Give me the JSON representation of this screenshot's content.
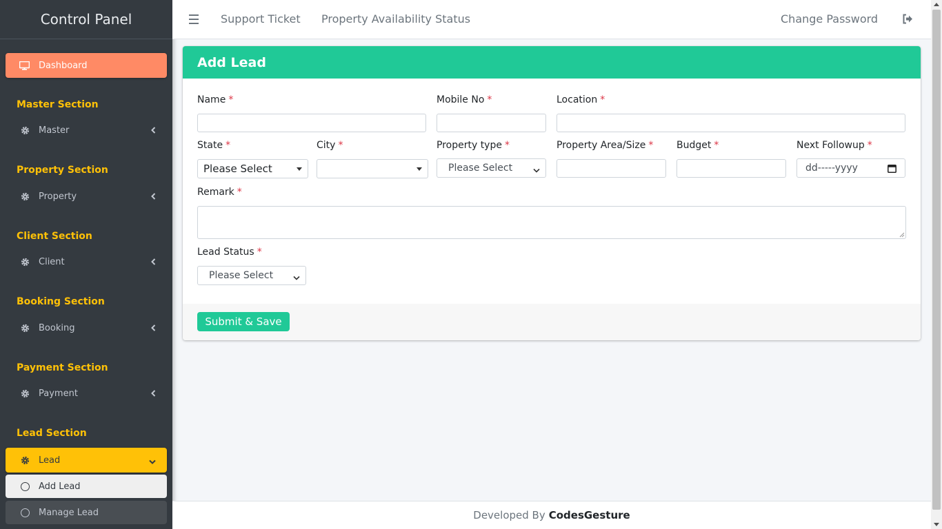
{
  "brand": "Control Panel",
  "sidebar": {
    "dashboard": "Dashboard",
    "sections": [
      {
        "header": "Master Section",
        "item": "Master"
      },
      {
        "header": "Property Section",
        "item": "Property"
      },
      {
        "header": "Client Section",
        "item": "Client"
      },
      {
        "header": "Booking Section",
        "item": "Booking"
      },
      {
        "header": "Payment Section",
        "item": "Payment"
      },
      {
        "header": "Lead Section",
        "item": "Lead"
      }
    ],
    "lead_sub": [
      "Add Lead",
      "Manage Lead"
    ]
  },
  "topnav": {
    "support": "Support Ticket",
    "availability": "Property Availability Status",
    "change_password": "Change Password"
  },
  "form": {
    "title": "Add Lead",
    "required_mark": "*",
    "name_label": "Name",
    "mobile_label": "Mobile No",
    "location_label": "Location",
    "state_label": "State",
    "state_value": "Please Select",
    "city_label": "City",
    "city_value": "",
    "property_type_label": "Property type",
    "property_type_value": "Please Select",
    "area_label": "Property Area/Size",
    "budget_label": "Budget",
    "followup_label": "Next Followup",
    "followup_placeholder": "dd-----yyyy",
    "remark_label": "Remark",
    "lead_status_label": "Lead Status",
    "lead_status_value": "Please Select",
    "submit": "Submit & Save"
  },
  "footer": {
    "prefix": "Developed By",
    "company": "CodesGesture"
  },
  "colors": {
    "accent": "#20c997",
    "dashboard_active": "#ff8a65",
    "section_header": "#ffc107",
    "sidebar_bg": "#343a40",
    "required": "#dc3545"
  }
}
